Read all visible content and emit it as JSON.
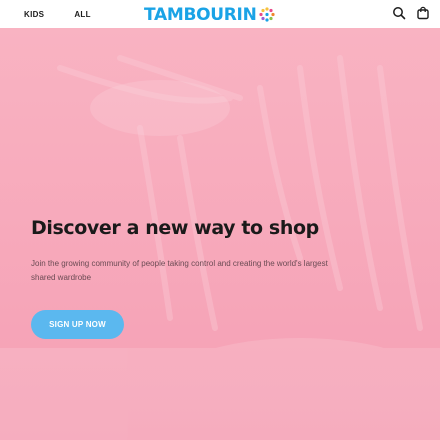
{
  "header": {
    "nav": [
      {
        "label": "KIDS"
      },
      {
        "label": "ALL"
      }
    ],
    "logo": {
      "text": "TAMBOURIN"
    },
    "icons": [
      "search-icon",
      "shopping-bag-icon"
    ]
  },
  "hero": {
    "headline": "Discover a new way to shop",
    "subtext": "Join the growing community of people taking control and creating the world's largest shared wardrobe",
    "cta_label": "SIGN UP NOW"
  },
  "colors": {
    "brand": "#1aa3e6",
    "hero_background": "#f7a6b8",
    "cta": "#5bb8ef"
  }
}
